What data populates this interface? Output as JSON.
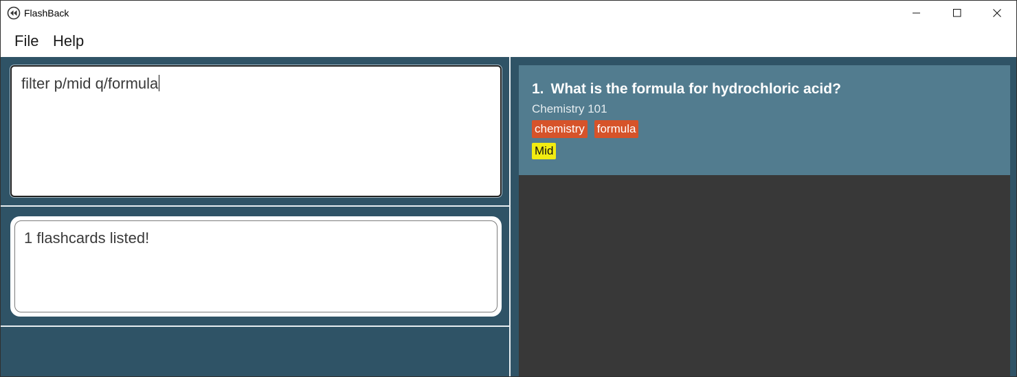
{
  "window": {
    "title": "FlashBack",
    "icon": "rewind-icon"
  },
  "menu": {
    "file": "File",
    "help": "Help"
  },
  "command_box": {
    "value": "filter p/mid q/formula"
  },
  "result_display": {
    "text": "1 flashcards listed!"
  },
  "flashcards": [
    {
      "index": "1.",
      "question": "What is the formula for hydrochloric acid?",
      "category": "Chemistry 101",
      "tags": [
        "chemistry",
        "formula"
      ],
      "priority": "Mid"
    }
  ],
  "colors": {
    "main_bg": "#2f5366",
    "card_bg": "#527c8f",
    "list_bg": "#383838",
    "tag_bg": "#d6532a",
    "priority_bg": "#f2ec11"
  }
}
